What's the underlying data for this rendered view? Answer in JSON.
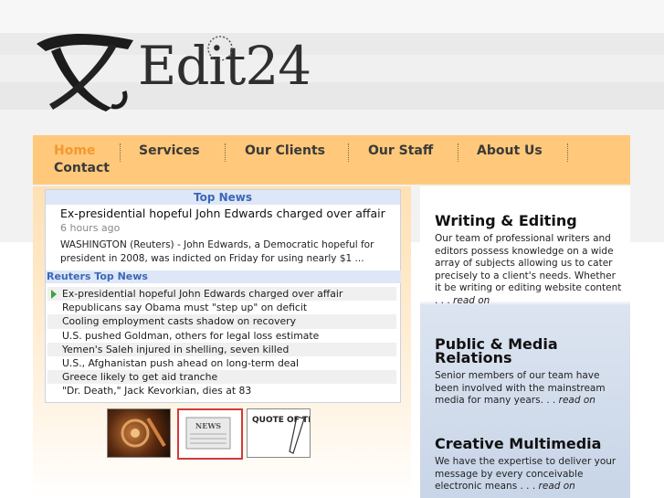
{
  "brand": {
    "name": "Edit24"
  },
  "nav": {
    "items": [
      {
        "label": "Home",
        "active": true
      },
      {
        "label": "Services"
      },
      {
        "label": "Our Clients"
      },
      {
        "label": "Our Staff"
      },
      {
        "label": "About Us"
      },
      {
        "label": "Contact"
      }
    ]
  },
  "news": {
    "header": "Top News",
    "featured": {
      "title": "Ex-presidential hopeful John Edwards charged over affair",
      "time": "6 hours ago",
      "body": "WASHINGTON (Reuters) - John Edwards, a Democratic hopeful for president in 2008, was indicted on Friday for using nearly $1 ..."
    },
    "reuters_header": "Reuters Top News",
    "headlines": [
      "Ex-presidential hopeful John Edwards charged over affair",
      "Republicans say Obama must \"step up\" on deficit",
      "Cooling employment casts shadow on recovery",
      "U.S. pushed Goldman, others for legal loss estimate",
      "Yemen's Saleh injured in shelling, seven killed",
      "U.S., Afghanistan push ahead on long-term deal",
      "Greece likely to get aid tranche",
      "\"Dr. Death,\" Jack Kevorkian, dies at 83"
    ]
  },
  "thumbnails": {
    "news_label": "NEWS",
    "quote_label": "QUOTE OF THE WEEK"
  },
  "sections": [
    {
      "title": "Writing & Editing",
      "body": "Our team of professional writers and editors possess knowledge on a wide array of subjects allowing us to cater precisely to a client's needs. Whether it be writing or editing website content . . .",
      "read_more": "read on"
    },
    {
      "title": "Public & Media Relations",
      "body": "Senior members of our team have been involved with the mainstream media for many years. . .",
      "read_more": "read on"
    },
    {
      "title": "Creative Multimedia",
      "body": "We have the expertise to deliver your message by every conceivable electronic means . . .",
      "read_more": "read on"
    }
  ],
  "colors": {
    "nav_bg": "#ffc87a",
    "nav_active": "#f29a2e",
    "news_header": "#3c66b8"
  }
}
